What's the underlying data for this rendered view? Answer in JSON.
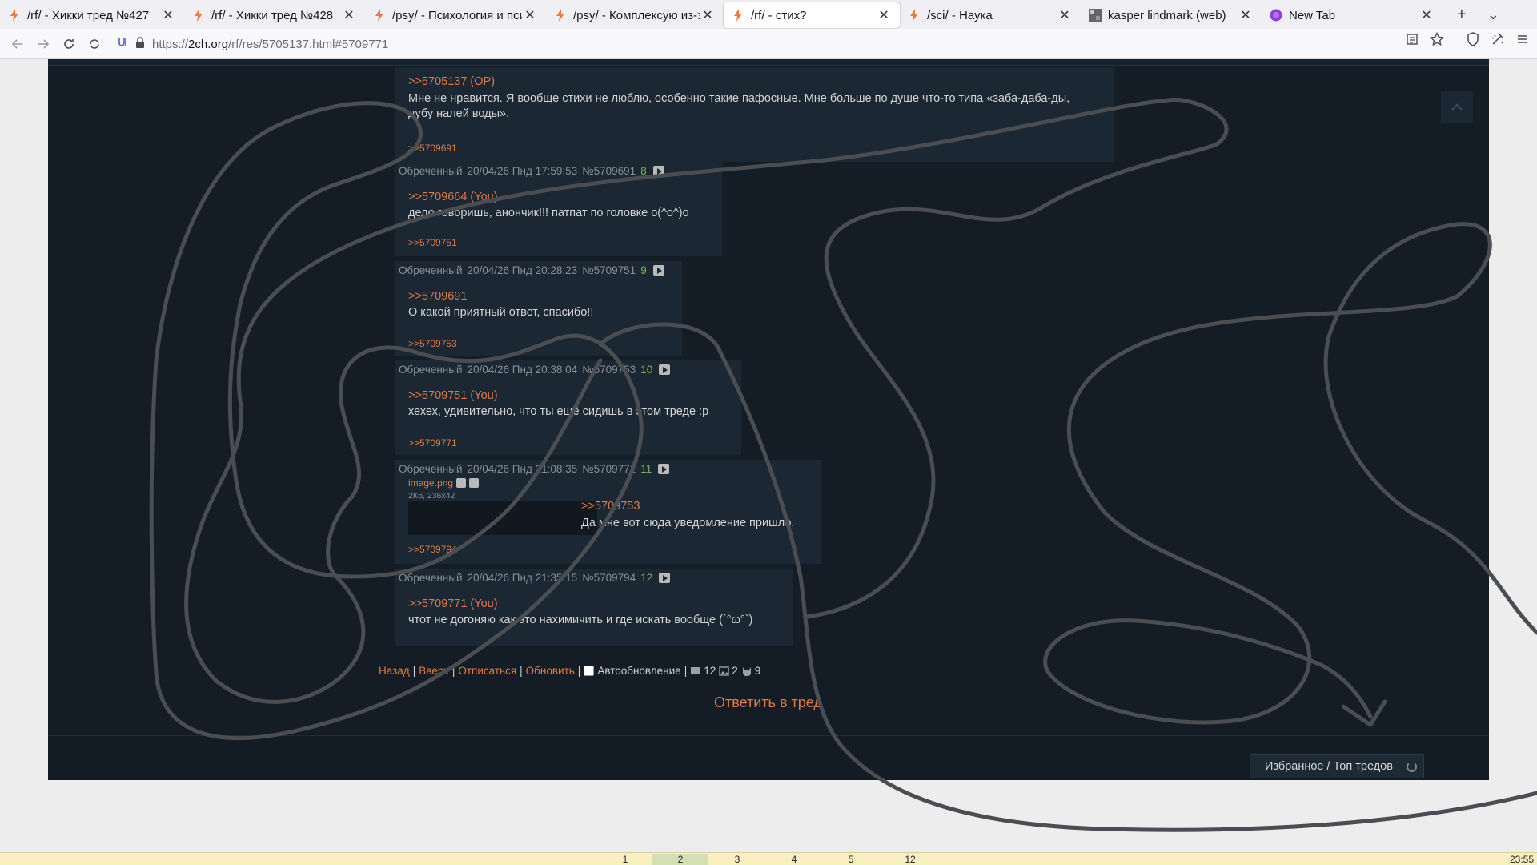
{
  "browser": {
    "tabs": [
      {
        "title": "/rf/ - Хикки тред №427",
        "favicon": "bolt-icon"
      },
      {
        "title": "/rf/ - Хикки тред №428",
        "favicon": "bolt-icon"
      },
      {
        "title": "/psy/ - Психология и псих",
        "favicon": "bolt-icon"
      },
      {
        "title": "/psy/ - Комплексую из-за",
        "favicon": "bolt-icon"
      },
      {
        "title": "/rf/ - стих?",
        "favicon": "bolt-icon",
        "active": true
      },
      {
        "title": "/sci/ - Наука",
        "favicon": "bolt-icon"
      },
      {
        "title": "kasper lindmark (web)",
        "favicon": "avatar-icon"
      },
      {
        "title": "New Tab",
        "favicon": "firefox-icon"
      }
    ],
    "close_glyph": "✕",
    "new_tab_glyph": "+",
    "list_tabs_glyph": "⌄",
    "url": {
      "prefix": "https://",
      "host": "2ch.org",
      "path": "/rf/res/5705137.html#5709771"
    }
  },
  "thread": {
    "posts": [
      {
        "id": "op_reply",
        "reply_to": ">>5705137 (OP)",
        "text_lines": [
          "Мне не нравится. Я вообще стихи не люблю, особенно такие пафосные. Мне больше по душе что-то типа «заба-даба-ды,",
          "дубу налей воды»."
        ],
        "backlink": ">>5709691"
      },
      {
        "id": "p5709691",
        "name": "Обреченный",
        "date": "20/04/26 Пнд 17:59:53",
        "num": "№5709691",
        "count": "8",
        "reply_to": ">>5709664 (You)",
        "text": "дело говоришь, анончик!!! патпат по головке o(^o^)o",
        "backlink": ">>5709751"
      },
      {
        "id": "p5709751",
        "name": "Обреченный",
        "date": "20/04/26 Пнд 20:28:23",
        "num": "№5709751",
        "count": "9",
        "reply_to": ">>5709691",
        "text": "О какой приятный ответ, спасибо!!",
        "backlink": ">>5709753"
      },
      {
        "id": "p5709753",
        "name": "Обреченный",
        "date": "20/04/26 Пнд 20:38:04",
        "num": "№5709753",
        "count": "10",
        "reply_to": ">>5709751 (You)",
        "text": "хехех, удивительно, что ты ещё сидишь в этом треде :р",
        "backlink": ">>5709771"
      },
      {
        "id": "p5709771",
        "name": "Обреченный",
        "date": "20/04/26 Пнд 21:08:35",
        "num": "№5709771",
        "count": "11",
        "file_name": "image.png",
        "file_info": "2Кб, 236x42",
        "reply_to": ">>5709753",
        "text": "Да мне вот сюда уведомление пришло.",
        "backlink": ">>5709794"
      },
      {
        "id": "p5709794",
        "name": "Обреченный",
        "date": "20/04/26 Пнд 21:35:15",
        "num": "№5709794",
        "count": "12",
        "reply_to": ">>5709771 (You)",
        "text": "чтот не догоняю как это нахимичить и где искать вообще (´°ω°`)"
      }
    ],
    "bottom_links": {
      "back": "Назад",
      "up": "Вверх",
      "unsubscribe": "Отписаться",
      "refresh": "Обновить",
      "autoupdate": "Автообновление",
      "posts_count": "12",
      "files_count": "2",
      "posters_count": "9"
    },
    "reply_button": "Ответить в тред",
    "favorites_button": "Избранное / Топ тредов"
  },
  "statusbar": {
    "workspaces": [
      "1",
      "2",
      "3",
      "4",
      "5",
      "12"
    ],
    "active_workspace": "2",
    "clock": "23:55"
  },
  "colors": {
    "page_bg": "#141d26",
    "post_bg": "#1b2733",
    "link": "#de7a45",
    "counter": "#7faf5c",
    "scribble": "#4a4d52"
  }
}
